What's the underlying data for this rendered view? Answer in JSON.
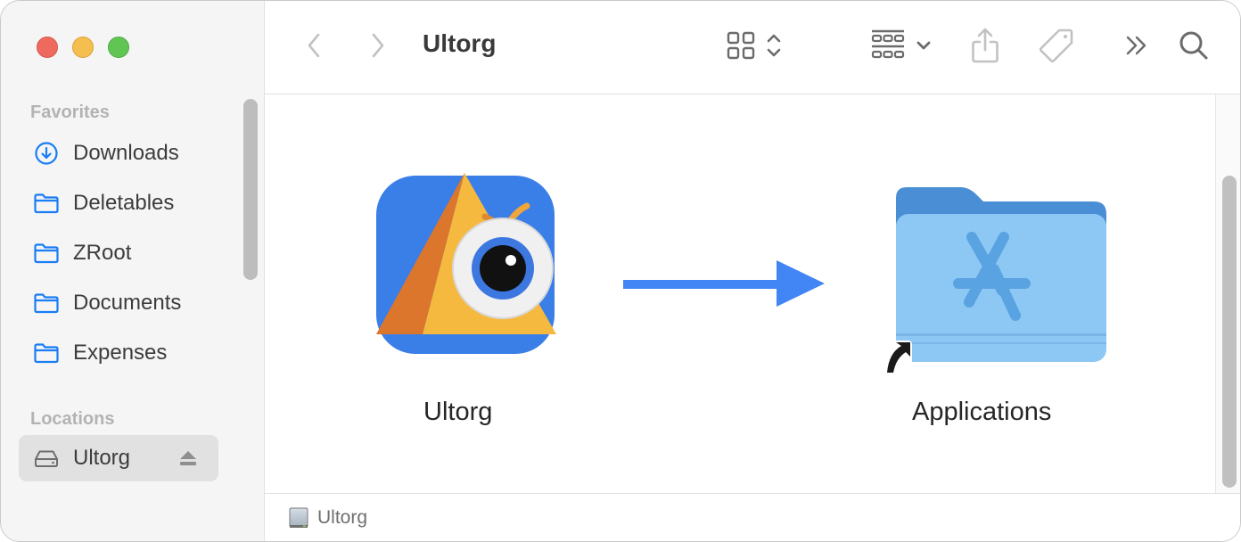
{
  "window": {
    "title": "Ultorg",
    "traffic_lights": {
      "close": "#ee6a5f",
      "minimize": "#f5bf4f",
      "maximize": "#61c554"
    }
  },
  "toolbar": {
    "back_icon": "chevron-left-icon",
    "forward_icon": "chevron-right-icon",
    "title": "Ultorg",
    "view_mode_icon": "icon-grid-view-icon",
    "group_icon": "group-by-icon",
    "share_icon": "share-icon",
    "tag_icon": "tag-icon",
    "more_icon": "chevron-double-right-icon",
    "search_icon": "search-icon"
  },
  "sidebar": {
    "favorites_label": "Favorites",
    "favorites": [
      {
        "label": "Downloads",
        "icon": "download-circle-icon"
      },
      {
        "label": "Deletables",
        "icon": "folder-icon"
      },
      {
        "label": "ZRoot",
        "icon": "folder-icon"
      },
      {
        "label": "Documents",
        "icon": "folder-icon"
      },
      {
        "label": "Expenses",
        "icon": "folder-icon"
      }
    ],
    "locations_label": "Locations",
    "locations": [
      {
        "label": "Ultorg",
        "icon": "drive-icon",
        "action_icon": "eject-icon",
        "selected": true
      }
    ]
  },
  "content": {
    "items": [
      {
        "label": "Ultorg",
        "icon": "ultorg-app-icon"
      },
      {
        "label": "Applications",
        "icon": "applications-folder-alias-icon"
      }
    ],
    "arrow_color": "#4285f4"
  },
  "statusbar": {
    "icon": "disk-volume-icon",
    "text": "Ultorg"
  },
  "colors": {
    "accent": "#1a7df5",
    "sidebar_bg": "#f5f5f5",
    "selected_bg": "#e1e1e1"
  }
}
